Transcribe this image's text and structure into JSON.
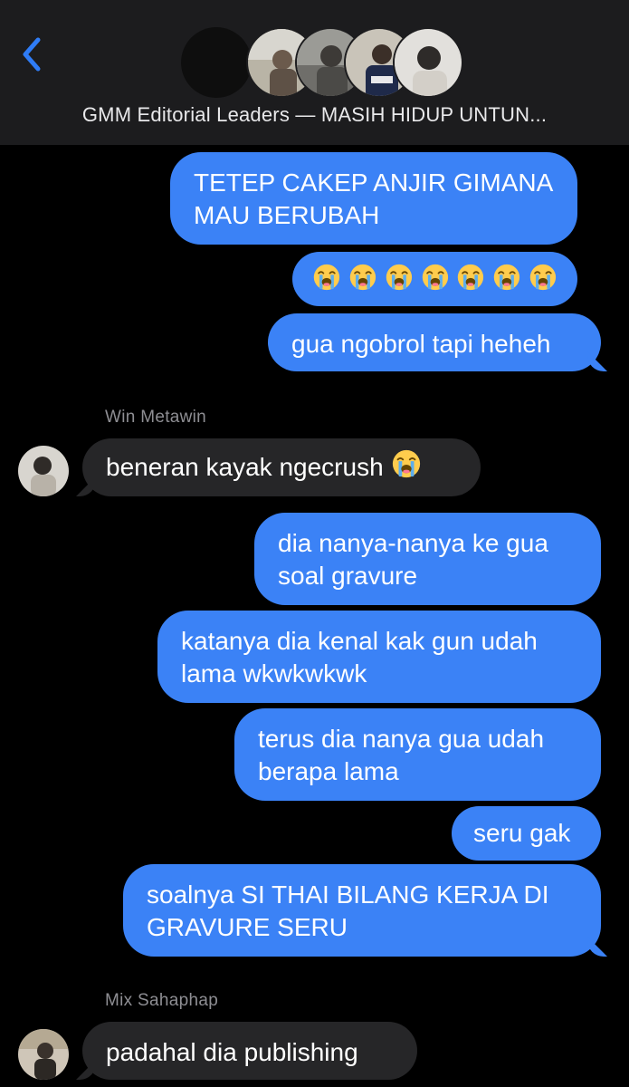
{
  "header": {
    "title": "GMM Editorial Leaders — MASIH HIDUP UNTUN..."
  },
  "colors": {
    "outgoing_bubble": "#3b82f6",
    "incoming_bubble": "#262628",
    "accent": "#2f7cf6",
    "background": "#000000"
  },
  "messages": [
    {
      "direction": "out",
      "lines": [
        "TETEP CAKEP ANJIR GIMANA",
        "MAU BERUBAH"
      ]
    },
    {
      "direction": "out",
      "emoji": "loudly-crying-face",
      "emoji_count": 7
    },
    {
      "direction": "out",
      "lines": [
        "gua ngobrol tapi heheh"
      ]
    },
    {
      "direction": "in",
      "sender": "Win Metawin",
      "text": "beneran kayak ngecrush",
      "emoji": "loudly-crying-face"
    },
    {
      "direction": "out",
      "lines": [
        "dia nanya-nanya ke gua",
        "soal gravure"
      ]
    },
    {
      "direction": "out",
      "lines": [
        "katanya dia kenal kak gun udah",
        "lama wkwkwkwk"
      ]
    },
    {
      "direction": "out",
      "lines": [
        "terus dia nanya gua udah",
        "berapa lama"
      ]
    },
    {
      "direction": "out",
      "lines": [
        "seru gak"
      ]
    },
    {
      "direction": "out",
      "lines": [
        "soalnya SI THAI BILANG KERJA DI",
        "GRAVURE SERU"
      ]
    },
    {
      "direction": "in",
      "sender": "Mix Sahaphap",
      "text": "padahal dia publishing"
    }
  ]
}
